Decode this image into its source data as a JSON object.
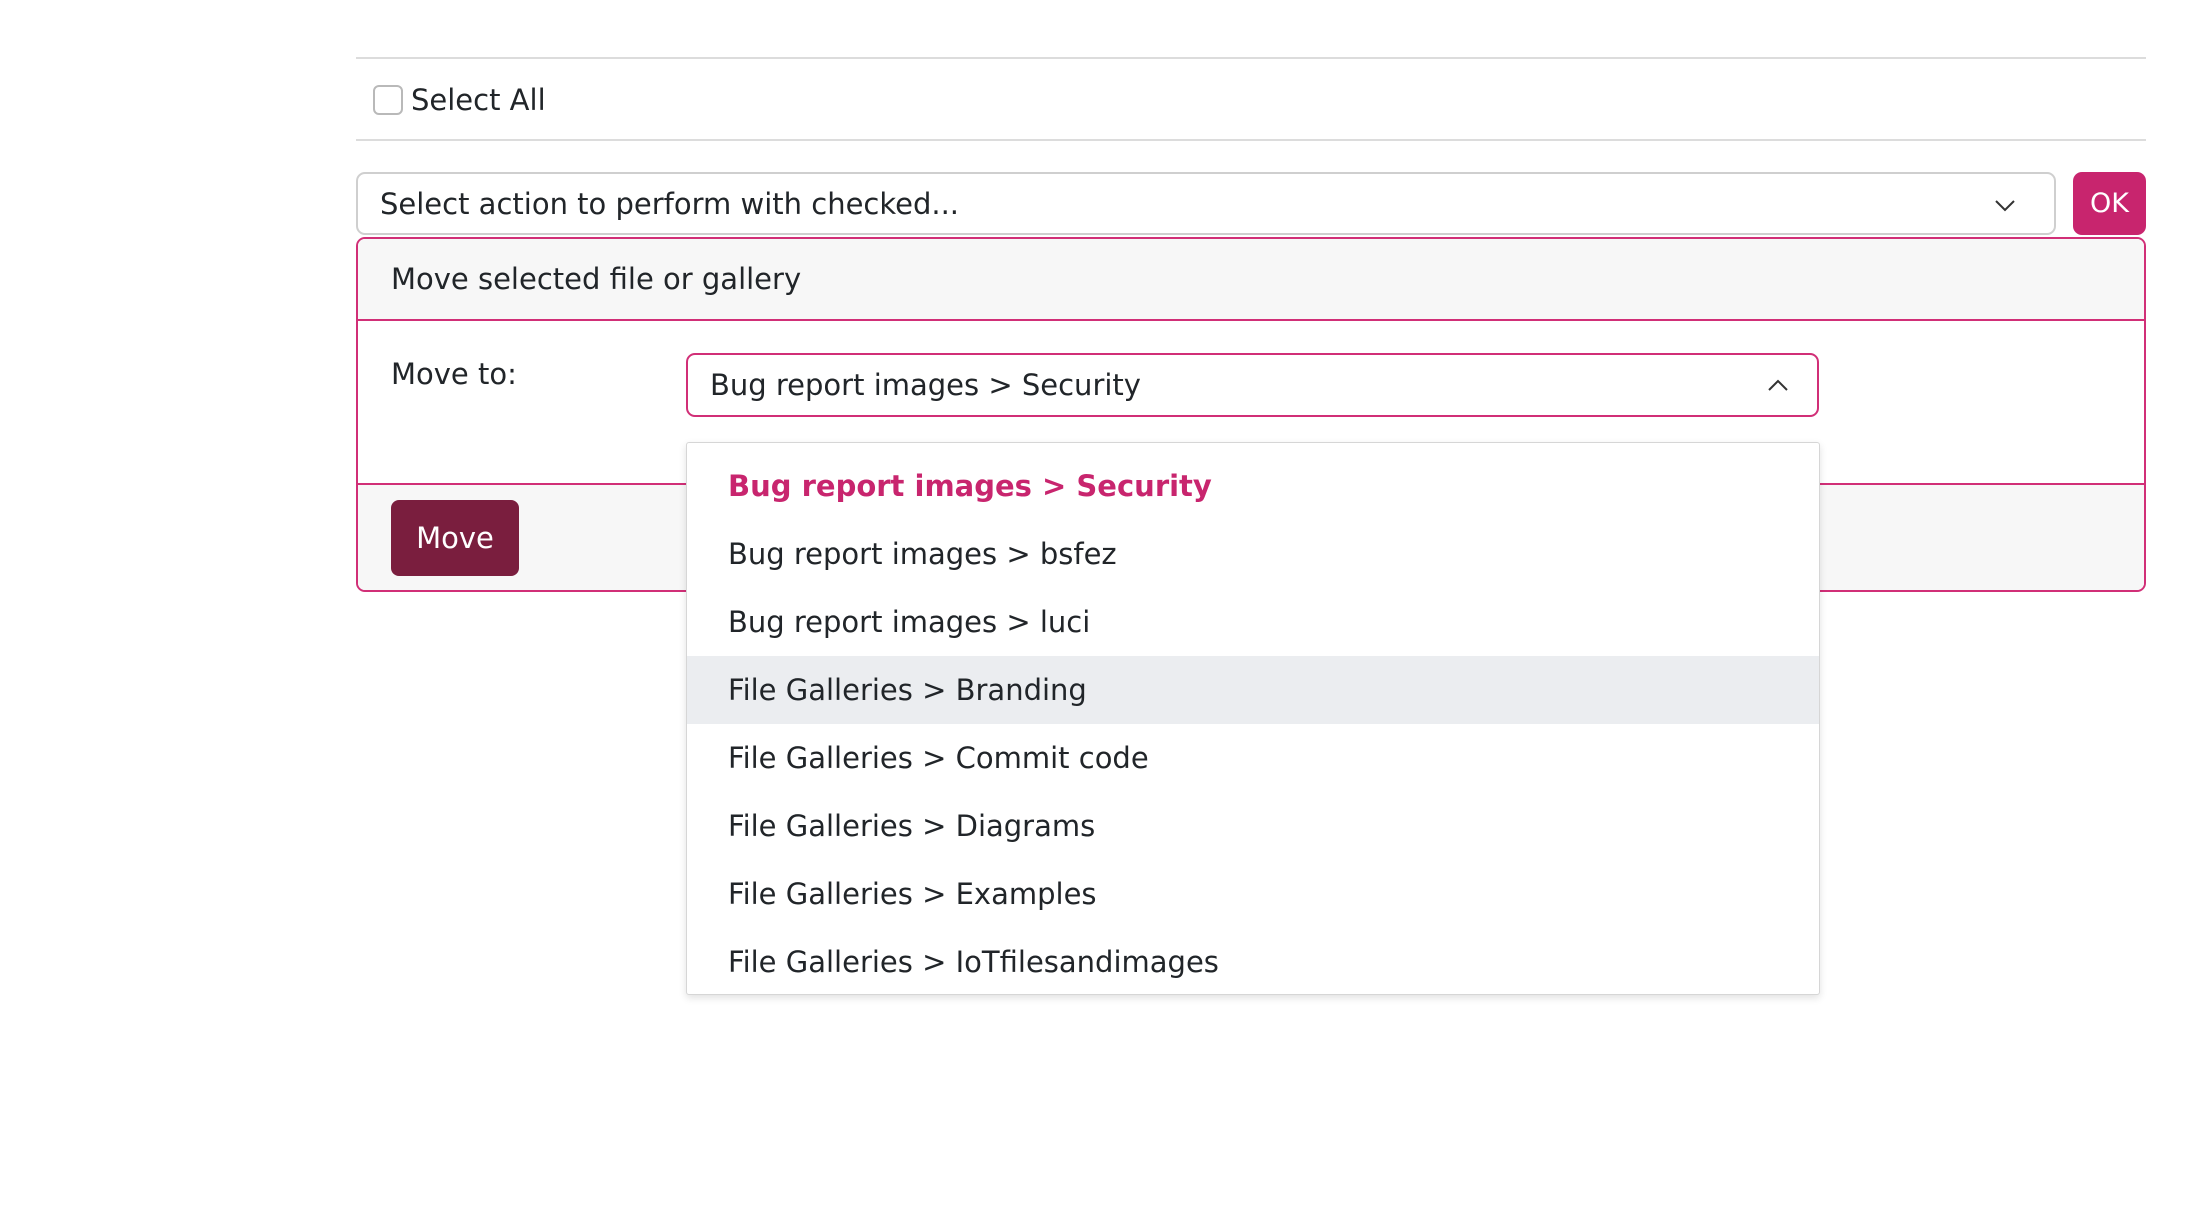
{
  "select_all": {
    "label": "Select All",
    "checked": false
  },
  "action_select": {
    "placeholder": "Select action to perform with checked..."
  },
  "ok_button": {
    "label": "OK"
  },
  "move_panel": {
    "title": "Move selected file or gallery",
    "move_to_label": "Move to:",
    "selected_value": "Bug report images > Security",
    "move_button_label": "Move"
  },
  "dropdown": {
    "options": [
      {
        "label": "Bug report images > Security",
        "state": "selected"
      },
      {
        "label": "Bug report images > bsfez",
        "state": "normal"
      },
      {
        "label": "Bug report images > luci",
        "state": "normal"
      },
      {
        "label": "File Galleries > Branding",
        "state": "hover"
      },
      {
        "label": "File Galleries > Commit code",
        "state": "normal"
      },
      {
        "label": "File Galleries > Diagrams",
        "state": "normal"
      },
      {
        "label": "File Galleries > Examples",
        "state": "normal"
      },
      {
        "label": "File Galleries > IoTfilesandimages",
        "state": "normal"
      }
    ]
  },
  "colors": {
    "accent": "#c8256e",
    "move_button": "#7a1e3e",
    "panel_border": "#d12f77",
    "hover_bg": "#ebedf0"
  },
  "icons": {
    "action_select": "chevron-down-icon",
    "dest_select": "chevron-up-icon"
  }
}
